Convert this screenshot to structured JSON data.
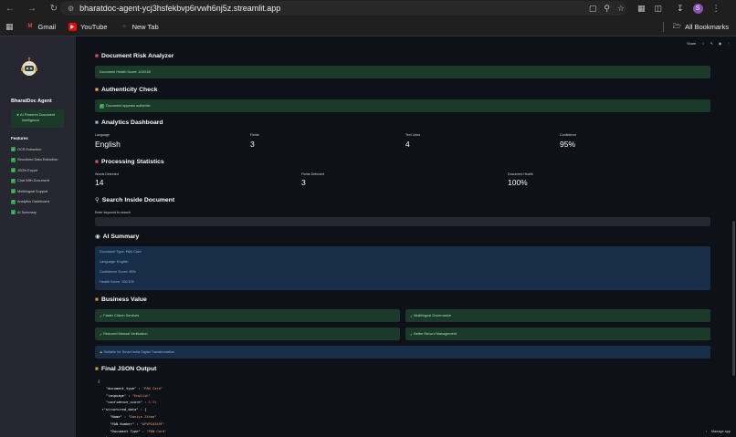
{
  "browser": {
    "url": "bharatdoc-agent-ycj3hsfekbvp6rvwh6nj5z.streamlit.app",
    "avatar_letter": "S",
    "bookmarks": [
      {
        "label": "Gmail",
        "icon": "gmail-icon"
      },
      {
        "label": "YouTube",
        "icon": "youtube-icon"
      },
      {
        "label": "New Tab",
        "icon": "globe-icon"
      }
    ],
    "all_bookmarks": "All Bookmarks"
  },
  "sidebar": {
    "title": "BharatDoc Agent",
    "badge_line1": "AI Powered Document",
    "badge_line2": "Intelligence",
    "features_heading": "Features",
    "features": [
      "OCR Extraction",
      "Structured Data Extraction",
      "JSON Export",
      "Chat With Document",
      "Multilingual Support",
      "Analytics Dashboard",
      "AI Summary"
    ]
  },
  "topbar": {
    "share": "Share"
  },
  "sections": {
    "risk": {
      "title": "Document Risk Analyzer",
      "message": "Document Health Score: 100/100"
    },
    "auth": {
      "title": "Authenticity Check",
      "message": "Document appears authentic"
    },
    "analytics": {
      "title": "Analytics Dashboard",
      "metrics": [
        {
          "label": "Language",
          "value": "English"
        },
        {
          "label": "Fields",
          "value": "3"
        },
        {
          "label": "Text Lines",
          "value": "4"
        },
        {
          "label": "Confidence",
          "value": "95%"
        }
      ]
    },
    "processing": {
      "title": "Processing Statistics",
      "metrics": [
        {
          "label": "Words Detected",
          "value": "14"
        },
        {
          "label": "Fields Detected",
          "value": "3"
        },
        {
          "label": "Document Health",
          "value": "100%"
        }
      ]
    },
    "search": {
      "title": "Search Inside Document",
      "label": "Enter keyword to search",
      "placeholder": ""
    },
    "ai_summary": {
      "title": "AI Summary",
      "lines": [
        "Document Type: PAN Card",
        "Language: English",
        "Confidence Score: 95%",
        "Health Score: 100/100"
      ]
    },
    "business": {
      "title": "Business Value",
      "items": [
        "Faster Citizen Services",
        "Multilingual Governance",
        "Reduced Manual Verification",
        "Better Record Management"
      ],
      "banner": "Suitable for Smart India Digital Transformation"
    },
    "json_output": {
      "title": "Final JSON Output",
      "document_type": "\"PAN Card\"",
      "language": "\"English\"",
      "confidence_score": "0.95",
      "name": "\"Daniya Zihaa\"",
      "pan_number": "\"APVPI0349F\"",
      "doc_type_value": "\"PAN Card\""
    }
  },
  "footer": {
    "manage_app": "Manage app"
  }
}
